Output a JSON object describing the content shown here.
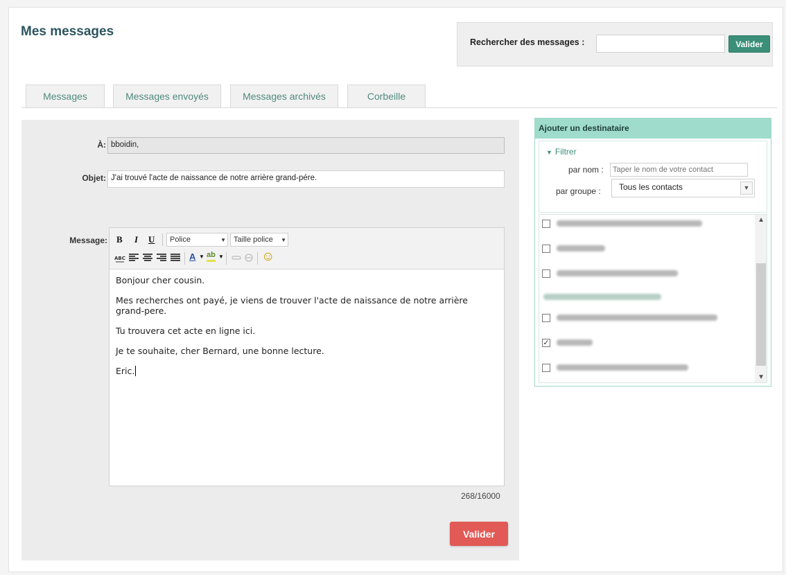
{
  "header": {
    "title": "Mes messages",
    "search_label": "Rechercher des messages :",
    "search_value": "",
    "search_button": "Valider"
  },
  "tabs": [
    {
      "label": "Messages"
    },
    {
      "label": "Messages envoyés"
    },
    {
      "label": "Messages archivés"
    },
    {
      "label": "Corbeille"
    }
  ],
  "form": {
    "to_label": "À:",
    "to_value": "bboidin,",
    "subject_label": "Objet:",
    "subject_value": "J'ai trouvé l'acte de naissance de notre arrière grand-pére.",
    "message_label": "Message:",
    "counter": "268/16000",
    "submit_label": "Valider"
  },
  "toolbar": {
    "bold": "B",
    "italic": "I",
    "underline": "U",
    "font_select": "Police",
    "size_select": "Taille police",
    "text_color": "A",
    "highlight": "ab",
    "emoticon": "☺"
  },
  "editor": {
    "paragraphs": [
      "Bonjour cher cousin.",
      "Mes recherches ont payé, je viens de trouver l'acte de naissance de notre arrière grand-pere.",
      "Tu trouvera cet acte en ligne ici.",
      "Je te souhaite, cher Bernard, une bonne lecture.",
      "Eric."
    ]
  },
  "sidebar": {
    "title": "Ajouter un destinataire",
    "filter_label": "Filtrer",
    "by_name_label": "par nom :",
    "by_name_placeholder": "Taper le nom de votre contact",
    "by_group_label": "par groupe :",
    "group_value": "Tous les contacts",
    "contacts": [
      {
        "checked": false
      },
      {
        "checked": false
      },
      {
        "checked": false
      },
      {
        "checked": false,
        "group_header": true
      },
      {
        "checked": false
      },
      {
        "checked": true
      },
      {
        "checked": false
      }
    ]
  },
  "colors": {
    "accent_green": "#3b8f78",
    "sidebar_header": "#9fdccc",
    "submit_red": "#e15a55",
    "title": "#2d5560"
  }
}
